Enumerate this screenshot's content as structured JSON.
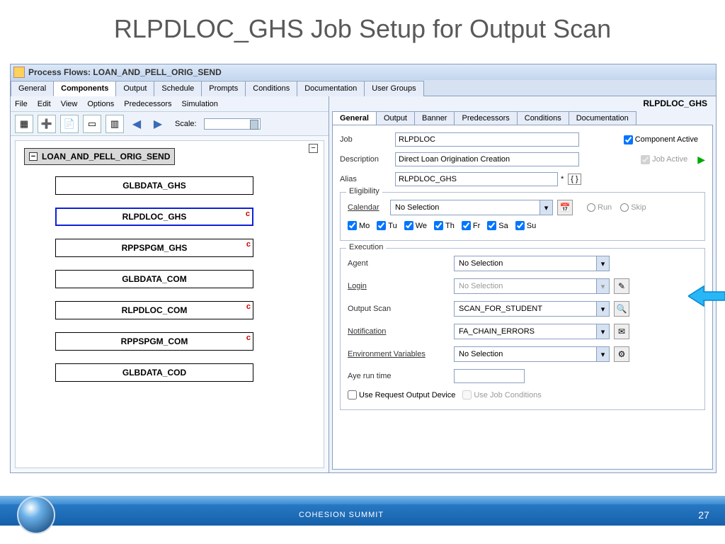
{
  "slide_title": "RLPDLOC_GHS Job Setup for Output Scan",
  "window_title": "Process Flows: LOAN_AND_PELL_ORIG_SEND",
  "main_tabs": [
    "General",
    "Components",
    "Output",
    "Schedule",
    "Prompts",
    "Conditions",
    "Documentation",
    "User Groups"
  ],
  "main_tab_active": 1,
  "menu": [
    "File",
    "Edit",
    "View",
    "Options",
    "Predecessors",
    "Simulation"
  ],
  "scale_label": "Scale:",
  "root_node": "LOAN_AND_PELL_ORIG_SEND",
  "jobs": [
    {
      "name": "GLBDATA_GHS",
      "c": false,
      "sel": false
    },
    {
      "name": "RLPDLOC_GHS",
      "c": true,
      "sel": true
    },
    {
      "name": "RPPSPGM_GHS",
      "c": true,
      "sel": false
    },
    {
      "name": "GLBDATA_COM",
      "c": false,
      "sel": false
    },
    {
      "name": "RLPDLOC_COM",
      "c": true,
      "sel": false
    },
    {
      "name": "RPPSPGM_COM",
      "c": true,
      "sel": false
    },
    {
      "name": "GLBDATA_COD",
      "c": false,
      "sel": false
    }
  ],
  "right_header": "RLPDLOC_GHS",
  "sub_tabs": [
    "General",
    "Output",
    "Banner",
    "Predecessors",
    "Conditions",
    "Documentation"
  ],
  "sub_tab_active": 0,
  "job_field_label": "Job",
  "job_field_value": "RLPDLOC",
  "desc_label": "Description",
  "desc_value": "Direct Loan Origination Creation",
  "alias_label": "Alias",
  "alias_value": "RLPDLOC_GHS",
  "comp_active_label": "Component Active",
  "job_active_label": "Job Active",
  "eligibility_legend": "Eligibility",
  "calendar_label": "Calendar",
  "calendar_value": "No Selection",
  "run_label": "Run",
  "skip_label": "Skip",
  "days": [
    "Mo",
    "Tu",
    "We",
    "Th",
    "Fr",
    "Sa",
    "Su"
  ],
  "execution_legend": "Execution",
  "exec": {
    "agent_label": "Agent",
    "agent_value": "No Selection",
    "login_label": "Login",
    "login_value": "No Selection",
    "outscan_label": "Output Scan",
    "outscan_value": "SCAN_FOR_STUDENT",
    "notif_label": "Notification",
    "notif_value": "FA_CHAIN_ERRORS",
    "env_label": "Environment Variables",
    "env_value": "No Selection",
    "aye_label": "Aye run time",
    "use_req_label": "Use Request Output Device",
    "use_cond_label": "Use Job Conditions"
  },
  "footer_text": "COHESION SUMMIT",
  "page_number": "27"
}
